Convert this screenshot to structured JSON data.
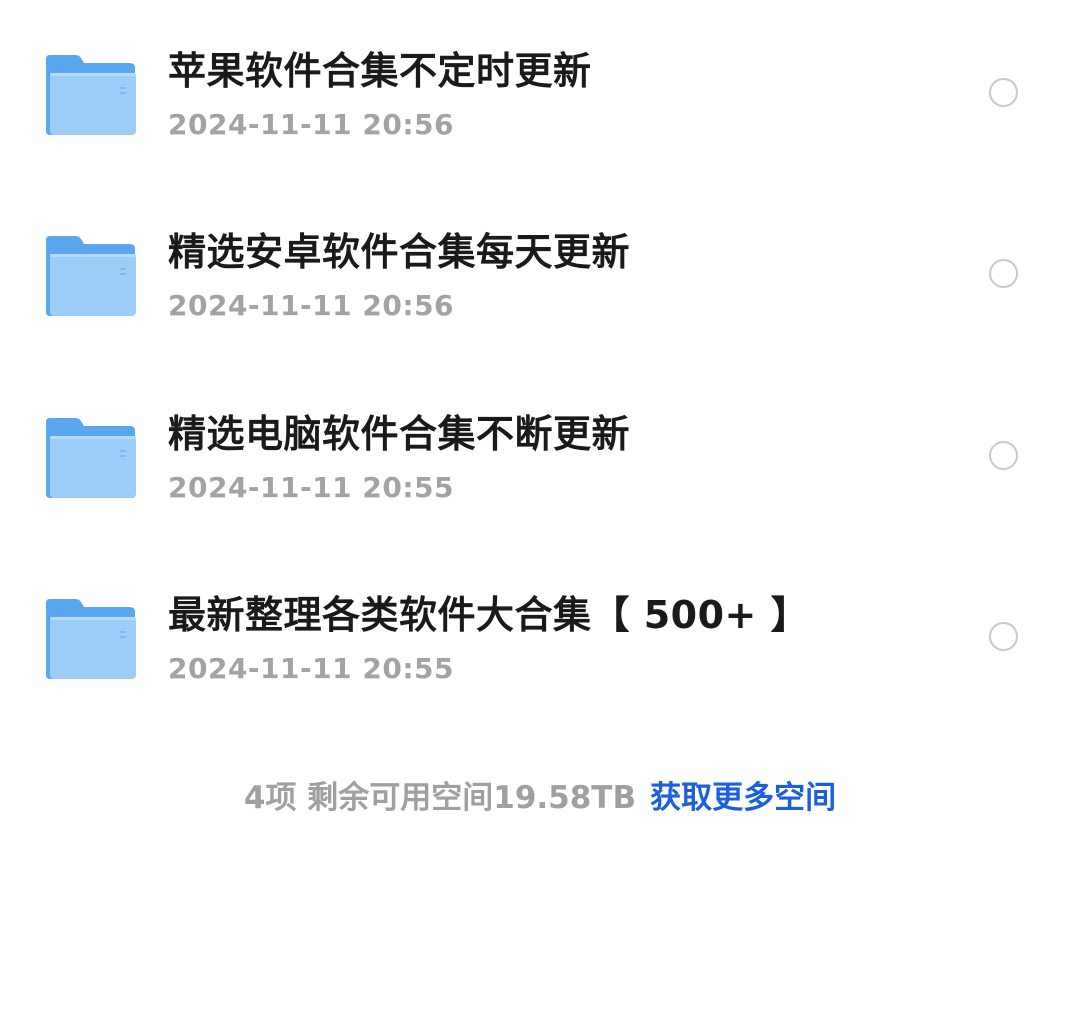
{
  "files": [
    {
      "name": "苹果软件合集不定时更新",
      "date": "2024-11-11 20:56",
      "icon": "folder-icon"
    },
    {
      "name": "精选安卓软件合集每天更新",
      "date": "2024-11-11 20:56",
      "icon": "folder-icon"
    },
    {
      "name": "精选电脑软件合集不断更新",
      "date": "2024-11-11 20:55",
      "icon": "folder-icon"
    },
    {
      "name": "最新整理各类软件大合集【 500+ 】",
      "date": "2024-11-11 20:55",
      "icon": "folder-icon"
    }
  ],
  "footer": {
    "summary": "4项 剩余可用空间19.58TB",
    "link_label": "获取更多空间"
  },
  "colors": {
    "folder_back": "#5aa7f0",
    "folder_front": "#9ccdf8",
    "link": "#1a5fe0",
    "muted_text": "#a3a3a3",
    "radio_border": "#c9c9c9"
  }
}
